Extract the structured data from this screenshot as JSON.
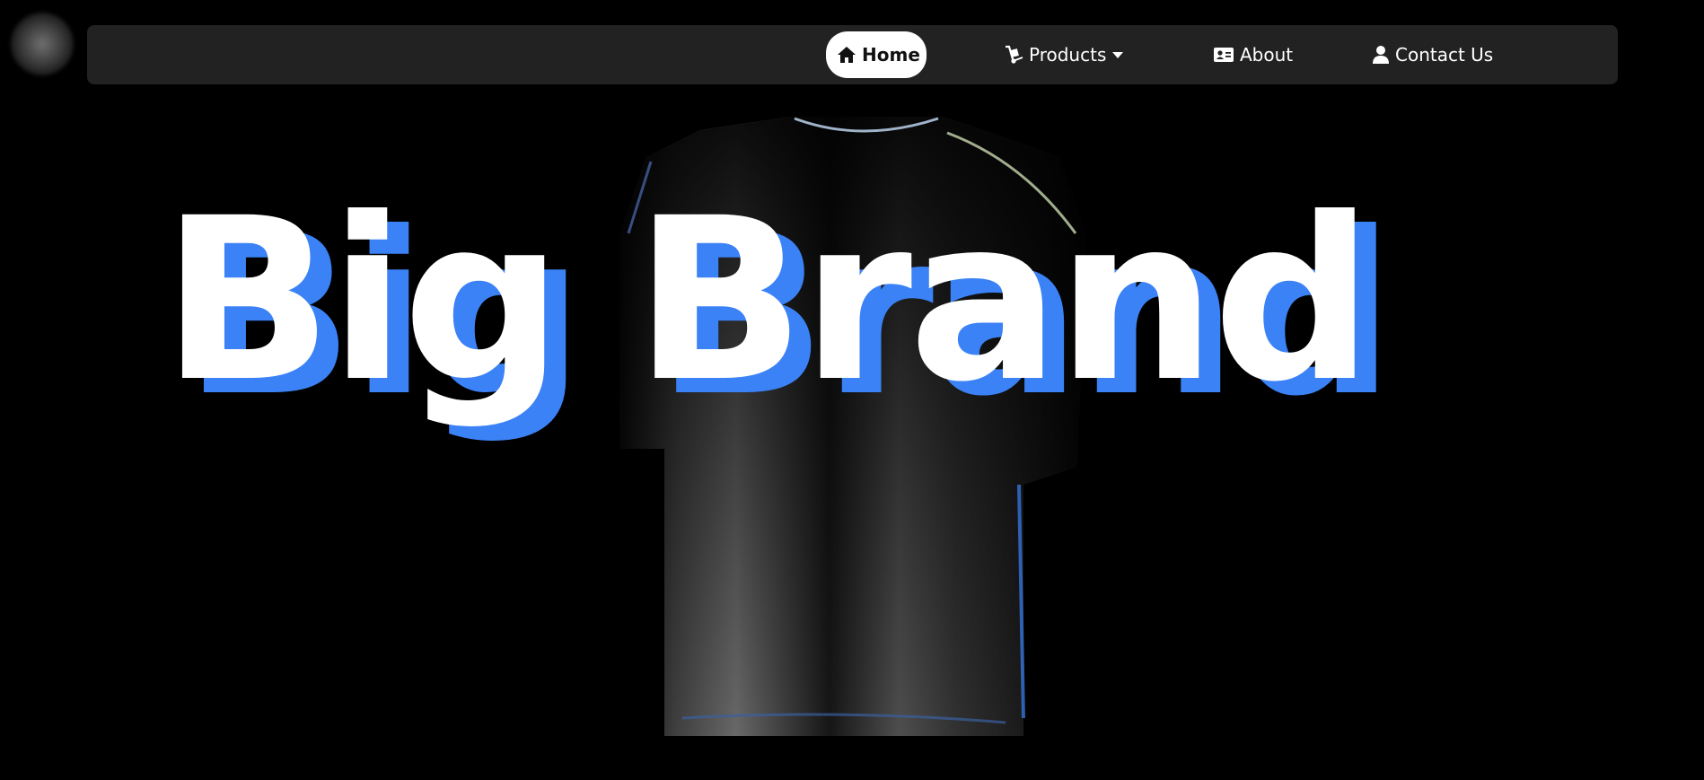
{
  "nav": {
    "items": [
      {
        "label": "Home",
        "icon": "home-icon",
        "active": true
      },
      {
        "label": "Products",
        "icon": "dolly-icon",
        "dropdown": true,
        "caret": "caret-down-icon"
      },
      {
        "label": "About",
        "icon": "id-card-icon"
      },
      {
        "label": "Contact Us",
        "icon": "user-icon"
      }
    ]
  },
  "hero": {
    "title": "Big Brand"
  },
  "colors": {
    "background": "#000000",
    "navbar": "#222222",
    "accent": "#3b82f6",
    "text": "#ffffff",
    "active_text": "#111111"
  }
}
